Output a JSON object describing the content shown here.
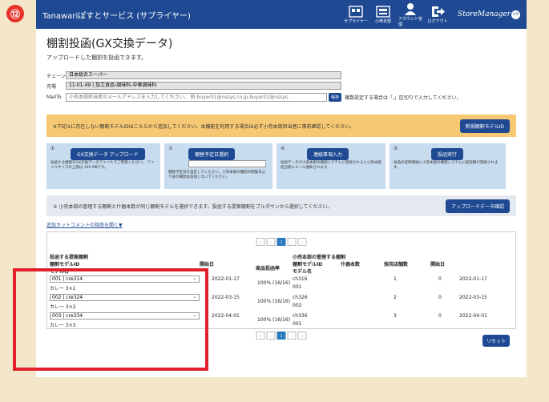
{
  "step_badge": "⑫",
  "header": {
    "brand": "Tanawariぽすとサービス (サプライヤー)",
    "icons": [
      {
        "name": "supplier-icon",
        "label": "サプライヤー"
      },
      {
        "name": "retail-hq-icon",
        "label": "小売本部"
      },
      {
        "name": "account-icon",
        "label": "アカウント管理"
      },
      {
        "name": "logout-icon",
        "label": "ログアウト"
      }
    ],
    "logo": "StoreManager",
    "logo_badge": "GX"
  },
  "page": {
    "title": "棚割投函(GX交換データ)",
    "subtitle": "アップロードした棚割を投函できます。"
  },
  "form": {
    "chain_label": "チェーン",
    "chain_value": "日本総合スーパー",
    "area_label": "売場",
    "area_value": "11-01-49 | 加工食品-調味料-中華調味料",
    "mailto_label": "MailTo",
    "mailto_placeholder": "小売本部担当者のメールアドレスを入力してください。 例:buyer01@nssys.co.jp,buyer02@nssys.",
    "save_label": "保存",
    "mailto_hint": "複数設定する場合は「,」区切りで入力してください。"
  },
  "notice": {
    "text": "※下記②に存在しない棚割モデルIDはこちらから追加してください。本機能を利用する場合は必ず小売本部担当者に事前確認してください。",
    "button": "新規棚割モデルID"
  },
  "steps": [
    {
      "num": "①",
      "button": "GX交換データ アップロード",
      "desc": "投函する棚割をGX交換データファイルでご用意ください。 ファイルサイズの上限は 100 MBです。"
    },
    {
      "num": "③",
      "button": "棚替予定日選択",
      "desc": "棚替予定日を設定してください。小売本部の棚割の閲覧日より前の棚割は投函しないでください。"
    },
    {
      "num": "④",
      "button": "連絡事項入力",
      "desc": "投函データが小売本部の棚割システムに登録されると小売本部担当者にメール通知されます。"
    },
    {
      "num": "⑤",
      "button": "投函実行",
      "desc": "投函の実時間後に小売本部の棚割システムに提案棚が登録されます。"
    }
  ],
  "bar2": {
    "text": "② 小売本部の管理する棚割と什器本数が同じ棚割モデルを選択できます。投函する提案棚割をプルダウンから選択してください。",
    "button": "アップロードデータ確認"
  },
  "toggle_link": "追加カットコメントの指南を開く▼",
  "pager": {
    "first": "«",
    "prev": "‹",
    "page": "1",
    "next": "›",
    "last": "»"
  },
  "table": {
    "left_group": "投函する提案棚割",
    "left_col1": "棚割モデルID",
    "left_col2": "モデル名",
    "col_date": "開始日",
    "col_rate": "商品投函率",
    "right_group": "小売本部の管理する棚割",
    "right_col1": "棚割モデルID",
    "right_col1b": "モデル名",
    "right_col2": "什器本数",
    "right_col3": "採用店舗数",
    "right_col4": "開始日",
    "rows": [
      {
        "select": "001 | cre314",
        "name": "カレー 3×1",
        "date": "2022-01-17",
        "rate": "100% (16/16)",
        "r_id": "ch316",
        "r_name": "001",
        "fixtures": "1",
        "stores": "0",
        "r_date": "2022-01-17"
      },
      {
        "select": "002 | cre324",
        "name": "カレー 3×2",
        "date": "2022-03-15",
        "rate": "100% (16/16)",
        "r_id": "ch326",
        "r_name": "002",
        "fixtures": "2",
        "stores": "0",
        "r_date": "2022-03-15"
      },
      {
        "select": "003 | cre334",
        "name": "カレー 3×3",
        "date": "2022-04-01",
        "rate": "100% (16/16)",
        "r_id": "ch336",
        "r_name": "001",
        "fixtures": "3",
        "stores": "0",
        "r_date": "2022-04-01"
      }
    ]
  },
  "reset_label": "リセット",
  "colors": {
    "navy": "#1f4a93",
    "notice": "#f6c873",
    "highlight": "#e0202a",
    "step_bg": "#c8dcef"
  }
}
